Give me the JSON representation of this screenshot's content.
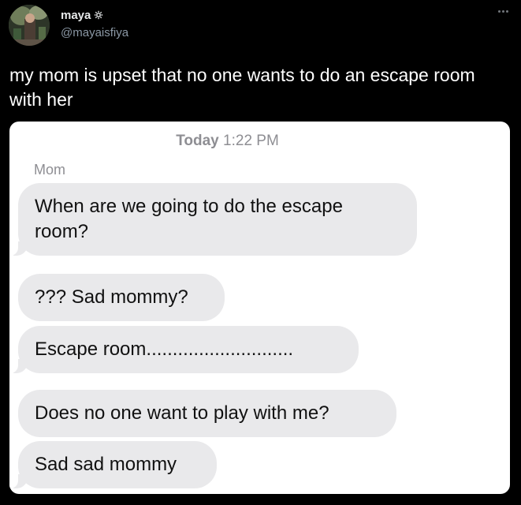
{
  "author": {
    "display_name": "maya",
    "badge_icon": "gear-badge-icon",
    "handle": "@mayaisfiya"
  },
  "more_icon": "more-horizontal-icon",
  "tweet": {
    "text": "my mom is upset that no one wants to do an escape room with her"
  },
  "screenshot": {
    "timestamp_day": "Today",
    "timestamp_time": "1:22 PM",
    "sender": "Mom",
    "messages": [
      "When are we going to do the escape room?",
      "??? Sad mommy?",
      "Escape room............................",
      "Does no one want to play with me?",
      "Sad sad mommy"
    ]
  },
  "colors": {
    "background": "#000000",
    "text_primary": "#e7e9ea",
    "text_secondary": "#8b98a5",
    "bubble_gray": "#e9e9eb"
  }
}
